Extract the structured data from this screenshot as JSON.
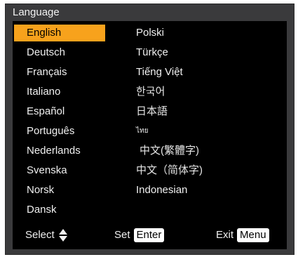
{
  "title": "Language",
  "languages_left": [
    "English",
    "Deutsch",
    "Français",
    "Italiano",
    "Español",
    "Português",
    "Nederlands",
    "Svenska",
    "Norsk",
    "Dansk"
  ],
  "languages_right": [
    "Polski",
    "Türkçe",
    "Tiếng Việt",
    "한국어",
    "日本語",
    "ไทย",
    "中文(繁體字)",
    "中文（简体字)",
    "Indonesian"
  ],
  "selected": "English",
  "footer": {
    "select_label": "Select",
    "set_label": "Set",
    "set_key": "Enter",
    "exit_label": "Exit",
    "exit_key": "Menu"
  },
  "colors": {
    "highlight": "#f7a21c",
    "panel": "#000000",
    "frame": "#3a3a3c"
  }
}
